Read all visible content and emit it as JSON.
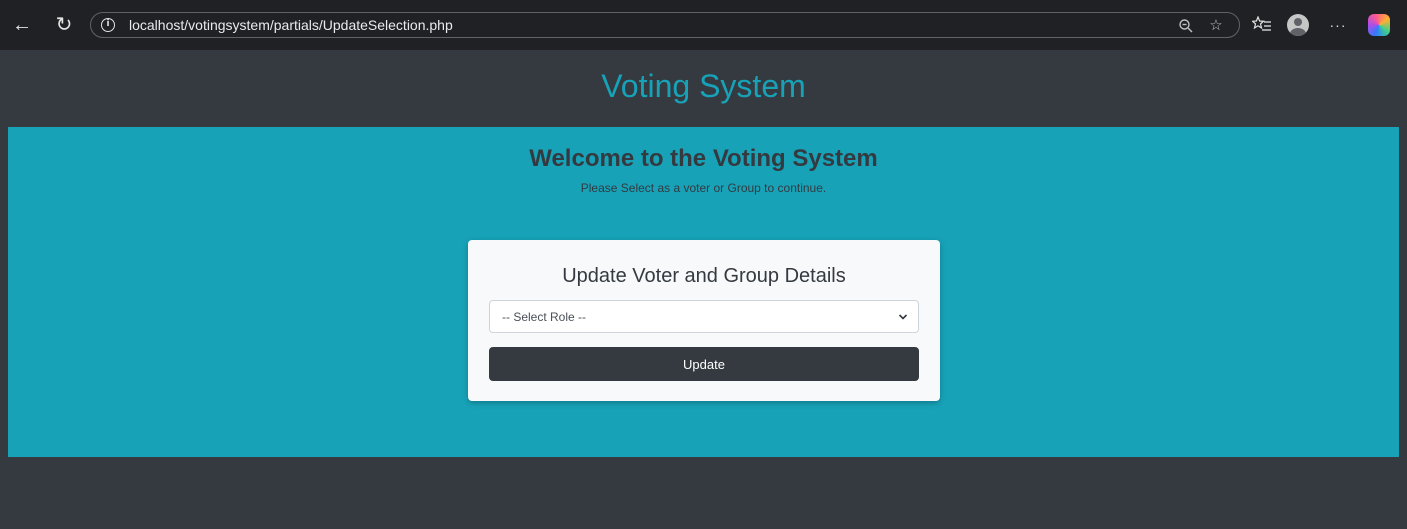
{
  "browser": {
    "url_host": "localhost",
    "url_path": "/votingsystem/partials/UpdateSelection.php",
    "icons": {
      "back": "back-arrow-icon",
      "refresh": "refresh-icon",
      "info": "info-icon",
      "zoom": "zoom-out-icon",
      "favorite": "star-icon",
      "favorites_list": "favorites-icon",
      "profile": "profile-icon",
      "more": "more-icon",
      "copilot": "copilot-icon"
    },
    "more_label": "···"
  },
  "header": {
    "title": "Voting System"
  },
  "hero": {
    "title": "Welcome to the Voting System",
    "subtitle": "Please Select as a voter or Group to continue."
  },
  "form": {
    "title": "Update Voter and Group Details",
    "select": {
      "selected": "-- Select Role --"
    },
    "submit_label": "Update"
  },
  "colors": {
    "accent": "#17a2b8",
    "dark": "#343a40",
    "card": "#f8f9fa",
    "chrome": "#202124"
  }
}
